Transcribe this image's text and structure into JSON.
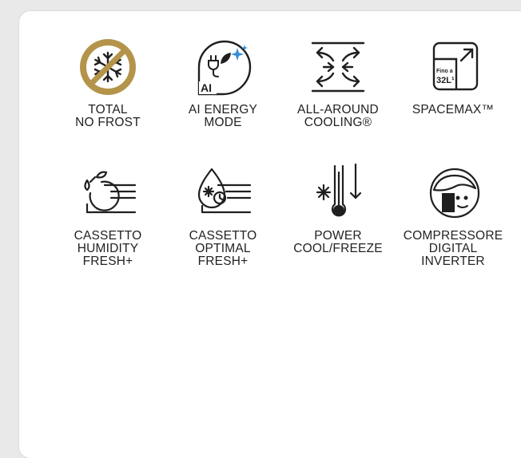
{
  "features": [
    {
      "icon": "no-frost-icon",
      "lines": [
        "TOTAL",
        "NO FROST"
      ]
    },
    {
      "icon": "ai-energy-icon",
      "lines": [
        "AI ENERGY",
        "MODE"
      ]
    },
    {
      "icon": "all-around-cooling-icon",
      "lines": [
        "ALL-AROUND",
        "COOLING®"
      ]
    },
    {
      "icon": "spacemax-icon",
      "lines": [
        "SPACEMAX™"
      ],
      "badge": [
        "Fino a",
        "32L¹"
      ]
    },
    {
      "icon": "humidity-drawer-icon",
      "lines": [
        "CASSETTO",
        "HUMIDITY",
        "FRESH+"
      ]
    },
    {
      "icon": "optimal-drawer-icon",
      "lines": [
        "CASSETTO",
        "OPTIMAL",
        "FRESH+"
      ]
    },
    {
      "icon": "power-cool-freeze-icon",
      "lines": [
        "POWER",
        "COOL/FREEZE"
      ]
    },
    {
      "icon": "compressor-inverter-icon",
      "lines": [
        "COMPRESSORE",
        "DIGITAL",
        "INVERTER"
      ]
    }
  ],
  "colors": {
    "gold": "#b4944a",
    "ink": "#1f1f1f",
    "sparkle": "#3a8fd8",
    "background": "#e9e9e9",
    "card": "#ffffff"
  }
}
